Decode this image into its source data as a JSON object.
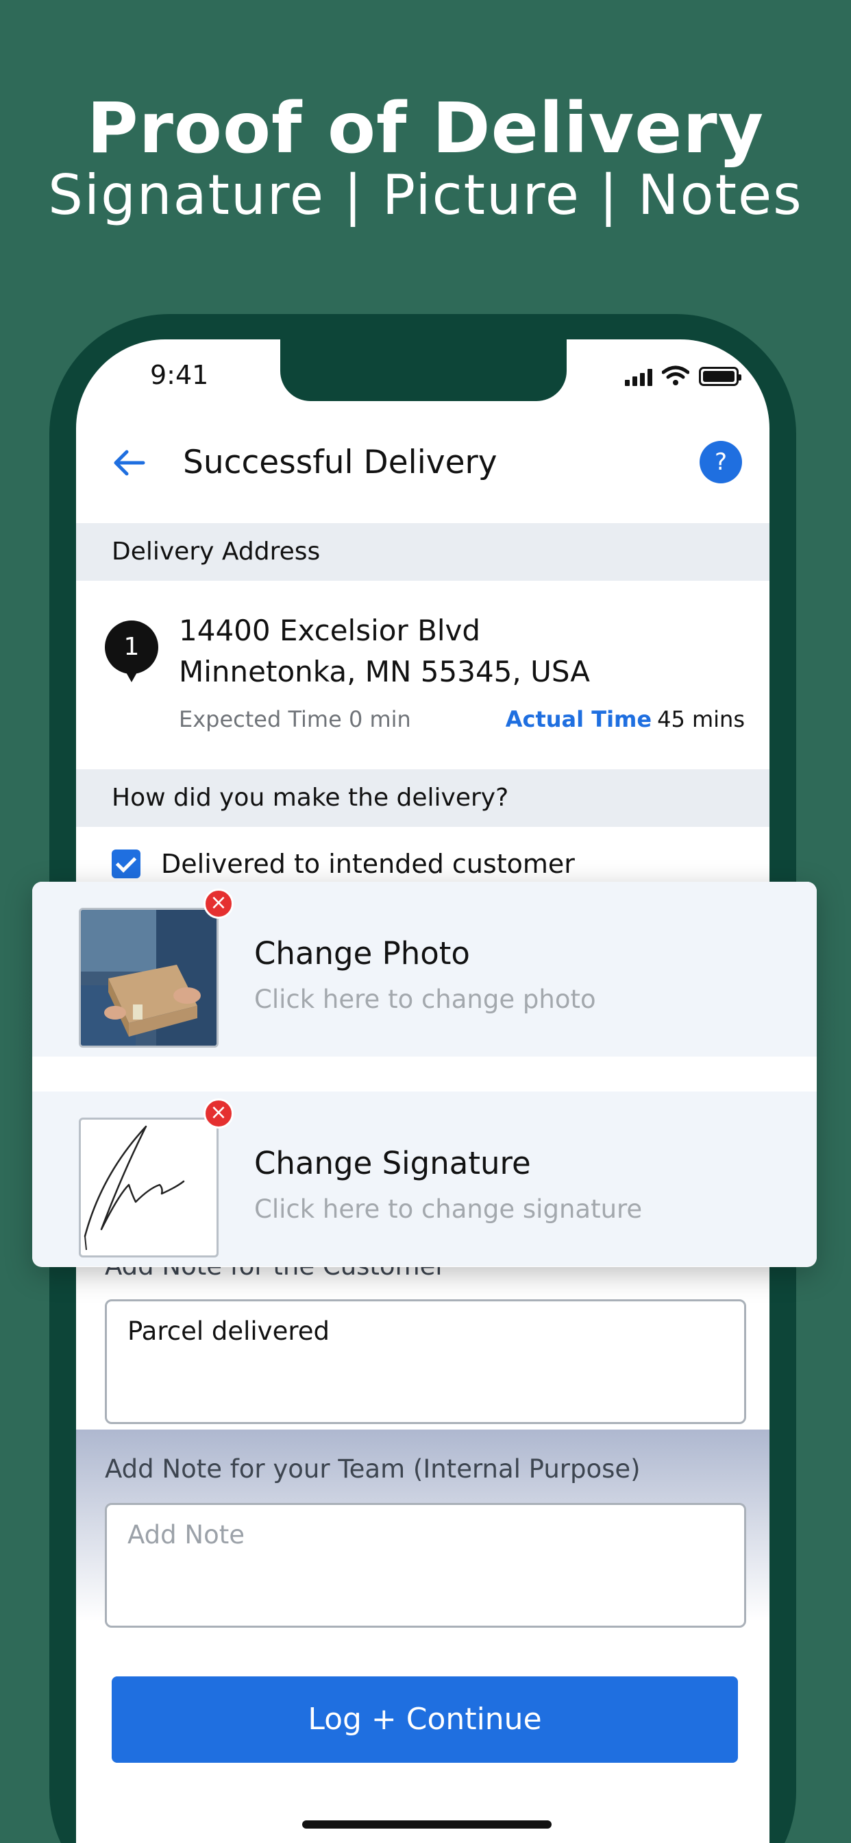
{
  "hero": {
    "title": "Proof of Delivery",
    "subtitle": "Signature | Picture | Notes"
  },
  "status_bar": {
    "time": "9:41",
    "icons": [
      "signal-icon",
      "wifi-icon",
      "battery-icon"
    ]
  },
  "appbar": {
    "back_icon": "arrow-left-icon",
    "title": "Successful Delivery",
    "help_label": "?"
  },
  "delivery_address": {
    "header": "Delivery Address",
    "stop_number": "1",
    "line1": "14400 Excelsior Blvd",
    "line2": "Minnetonka, MN 55345, USA",
    "expected_time": "Expected Time 0 min",
    "actual_time_label": "Actual Time",
    "actual_time_value": "45 mins"
  },
  "delivery_method": {
    "header": "How did you make the delivery?",
    "option_label": "Delivered to intended customer",
    "checked": true
  },
  "attachments": {
    "photo": {
      "title": "Change Photo",
      "subtitle": "Click here to change photo",
      "remove": "×"
    },
    "signature": {
      "title": "Change Signature",
      "subtitle": "Click here to change signature",
      "remove": "×"
    }
  },
  "notes": {
    "customer_label": "Add Note for the Customer",
    "customer_value": "Parcel delivered",
    "team_label": "Add Note for your Team (Internal Purpose)",
    "team_placeholder": "Add Note"
  },
  "primary_action": "Log + Continue",
  "colors": {
    "background": "#2f6a58",
    "phone_frame": "#0d4538",
    "accent": "#1f6fe0",
    "remove": "#e53030"
  }
}
